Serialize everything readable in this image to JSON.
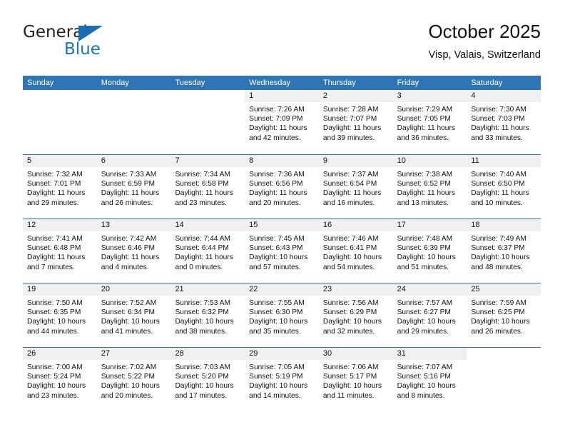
{
  "brand": {
    "name_part1": "General",
    "name_part2": "Blue",
    "accent_color": "#1b6cb0"
  },
  "header": {
    "title": "October 2025",
    "subtitle": "Visp, Valais, Switzerland"
  },
  "calendar": {
    "header_bg": "#2f75b5",
    "weekdays": [
      "Sunday",
      "Monday",
      "Tuesday",
      "Wednesday",
      "Thursday",
      "Friday",
      "Saturday"
    ],
    "weeks": [
      [
        {
          "day": "",
          "blank": true
        },
        {
          "day": "",
          "blank": true
        },
        {
          "day": "",
          "blank": true
        },
        {
          "day": "1",
          "sunrise": "Sunrise: 7:26 AM",
          "sunset": "Sunset: 7:09 PM",
          "daylight_1": "Daylight: 11 hours",
          "daylight_2": "and 42 minutes."
        },
        {
          "day": "2",
          "sunrise": "Sunrise: 7:28 AM",
          "sunset": "Sunset: 7:07 PM",
          "daylight_1": "Daylight: 11 hours",
          "daylight_2": "and 39 minutes."
        },
        {
          "day": "3",
          "sunrise": "Sunrise: 7:29 AM",
          "sunset": "Sunset: 7:05 PM",
          "daylight_1": "Daylight: 11 hours",
          "daylight_2": "and 36 minutes."
        },
        {
          "day": "4",
          "sunrise": "Sunrise: 7:30 AM",
          "sunset": "Sunset: 7:03 PM",
          "daylight_1": "Daylight: 11 hours",
          "daylight_2": "and 33 minutes."
        }
      ],
      [
        {
          "day": "5",
          "sunrise": "Sunrise: 7:32 AM",
          "sunset": "Sunset: 7:01 PM",
          "daylight_1": "Daylight: 11 hours",
          "daylight_2": "and 29 minutes."
        },
        {
          "day": "6",
          "sunrise": "Sunrise: 7:33 AM",
          "sunset": "Sunset: 6:59 PM",
          "daylight_1": "Daylight: 11 hours",
          "daylight_2": "and 26 minutes."
        },
        {
          "day": "7",
          "sunrise": "Sunrise: 7:34 AM",
          "sunset": "Sunset: 6:58 PM",
          "daylight_1": "Daylight: 11 hours",
          "daylight_2": "and 23 minutes."
        },
        {
          "day": "8",
          "sunrise": "Sunrise: 7:36 AM",
          "sunset": "Sunset: 6:56 PM",
          "daylight_1": "Daylight: 11 hours",
          "daylight_2": "and 20 minutes."
        },
        {
          "day": "9",
          "sunrise": "Sunrise: 7:37 AM",
          "sunset": "Sunset: 6:54 PM",
          "daylight_1": "Daylight: 11 hours",
          "daylight_2": "and 16 minutes."
        },
        {
          "day": "10",
          "sunrise": "Sunrise: 7:38 AM",
          "sunset": "Sunset: 6:52 PM",
          "daylight_1": "Daylight: 11 hours",
          "daylight_2": "and 13 minutes."
        },
        {
          "day": "11",
          "sunrise": "Sunrise: 7:40 AM",
          "sunset": "Sunset: 6:50 PM",
          "daylight_1": "Daylight: 11 hours",
          "daylight_2": "and 10 minutes."
        }
      ],
      [
        {
          "day": "12",
          "sunrise": "Sunrise: 7:41 AM",
          "sunset": "Sunset: 6:48 PM",
          "daylight_1": "Daylight: 11 hours",
          "daylight_2": "and 7 minutes."
        },
        {
          "day": "13",
          "sunrise": "Sunrise: 7:42 AM",
          "sunset": "Sunset: 6:46 PM",
          "daylight_1": "Daylight: 11 hours",
          "daylight_2": "and 4 minutes."
        },
        {
          "day": "14",
          "sunrise": "Sunrise: 7:44 AM",
          "sunset": "Sunset: 6:44 PM",
          "daylight_1": "Daylight: 11 hours",
          "daylight_2": "and 0 minutes."
        },
        {
          "day": "15",
          "sunrise": "Sunrise: 7:45 AM",
          "sunset": "Sunset: 6:43 PM",
          "daylight_1": "Daylight: 10 hours",
          "daylight_2": "and 57 minutes."
        },
        {
          "day": "16",
          "sunrise": "Sunrise: 7:46 AM",
          "sunset": "Sunset: 6:41 PM",
          "daylight_1": "Daylight: 10 hours",
          "daylight_2": "and 54 minutes."
        },
        {
          "day": "17",
          "sunrise": "Sunrise: 7:48 AM",
          "sunset": "Sunset: 6:39 PM",
          "daylight_1": "Daylight: 10 hours",
          "daylight_2": "and 51 minutes."
        },
        {
          "day": "18",
          "sunrise": "Sunrise: 7:49 AM",
          "sunset": "Sunset: 6:37 PM",
          "daylight_1": "Daylight: 10 hours",
          "daylight_2": "and 48 minutes."
        }
      ],
      [
        {
          "day": "19",
          "sunrise": "Sunrise: 7:50 AM",
          "sunset": "Sunset: 6:35 PM",
          "daylight_1": "Daylight: 10 hours",
          "daylight_2": "and 44 minutes."
        },
        {
          "day": "20",
          "sunrise": "Sunrise: 7:52 AM",
          "sunset": "Sunset: 6:34 PM",
          "daylight_1": "Daylight: 10 hours",
          "daylight_2": "and 41 minutes."
        },
        {
          "day": "21",
          "sunrise": "Sunrise: 7:53 AM",
          "sunset": "Sunset: 6:32 PM",
          "daylight_1": "Daylight: 10 hours",
          "daylight_2": "and 38 minutes."
        },
        {
          "day": "22",
          "sunrise": "Sunrise: 7:55 AM",
          "sunset": "Sunset: 6:30 PM",
          "daylight_1": "Daylight: 10 hours",
          "daylight_2": "and 35 minutes."
        },
        {
          "day": "23",
          "sunrise": "Sunrise: 7:56 AM",
          "sunset": "Sunset: 6:29 PM",
          "daylight_1": "Daylight: 10 hours",
          "daylight_2": "and 32 minutes."
        },
        {
          "day": "24",
          "sunrise": "Sunrise: 7:57 AM",
          "sunset": "Sunset: 6:27 PM",
          "daylight_1": "Daylight: 10 hours",
          "daylight_2": "and 29 minutes."
        },
        {
          "day": "25",
          "sunrise": "Sunrise: 7:59 AM",
          "sunset": "Sunset: 6:25 PM",
          "daylight_1": "Daylight: 10 hours",
          "daylight_2": "and 26 minutes."
        }
      ],
      [
        {
          "day": "26",
          "sunrise": "Sunrise: 7:00 AM",
          "sunset": "Sunset: 5:24 PM",
          "daylight_1": "Daylight: 10 hours",
          "daylight_2": "and 23 minutes."
        },
        {
          "day": "27",
          "sunrise": "Sunrise: 7:02 AM",
          "sunset": "Sunset: 5:22 PM",
          "daylight_1": "Daylight: 10 hours",
          "daylight_2": "and 20 minutes."
        },
        {
          "day": "28",
          "sunrise": "Sunrise: 7:03 AM",
          "sunset": "Sunset: 5:20 PM",
          "daylight_1": "Daylight: 10 hours",
          "daylight_2": "and 17 minutes."
        },
        {
          "day": "29",
          "sunrise": "Sunrise: 7:05 AM",
          "sunset": "Sunset: 5:19 PM",
          "daylight_1": "Daylight: 10 hours",
          "daylight_2": "and 14 minutes."
        },
        {
          "day": "30",
          "sunrise": "Sunrise: 7:06 AM",
          "sunset": "Sunset: 5:17 PM",
          "daylight_1": "Daylight: 10 hours",
          "daylight_2": "and 11 minutes."
        },
        {
          "day": "31",
          "sunrise": "Sunrise: 7:07 AM",
          "sunset": "Sunset: 5:16 PM",
          "daylight_1": "Daylight: 10 hours",
          "daylight_2": "and 8 minutes."
        },
        {
          "day": "",
          "blank": true
        }
      ]
    ]
  }
}
